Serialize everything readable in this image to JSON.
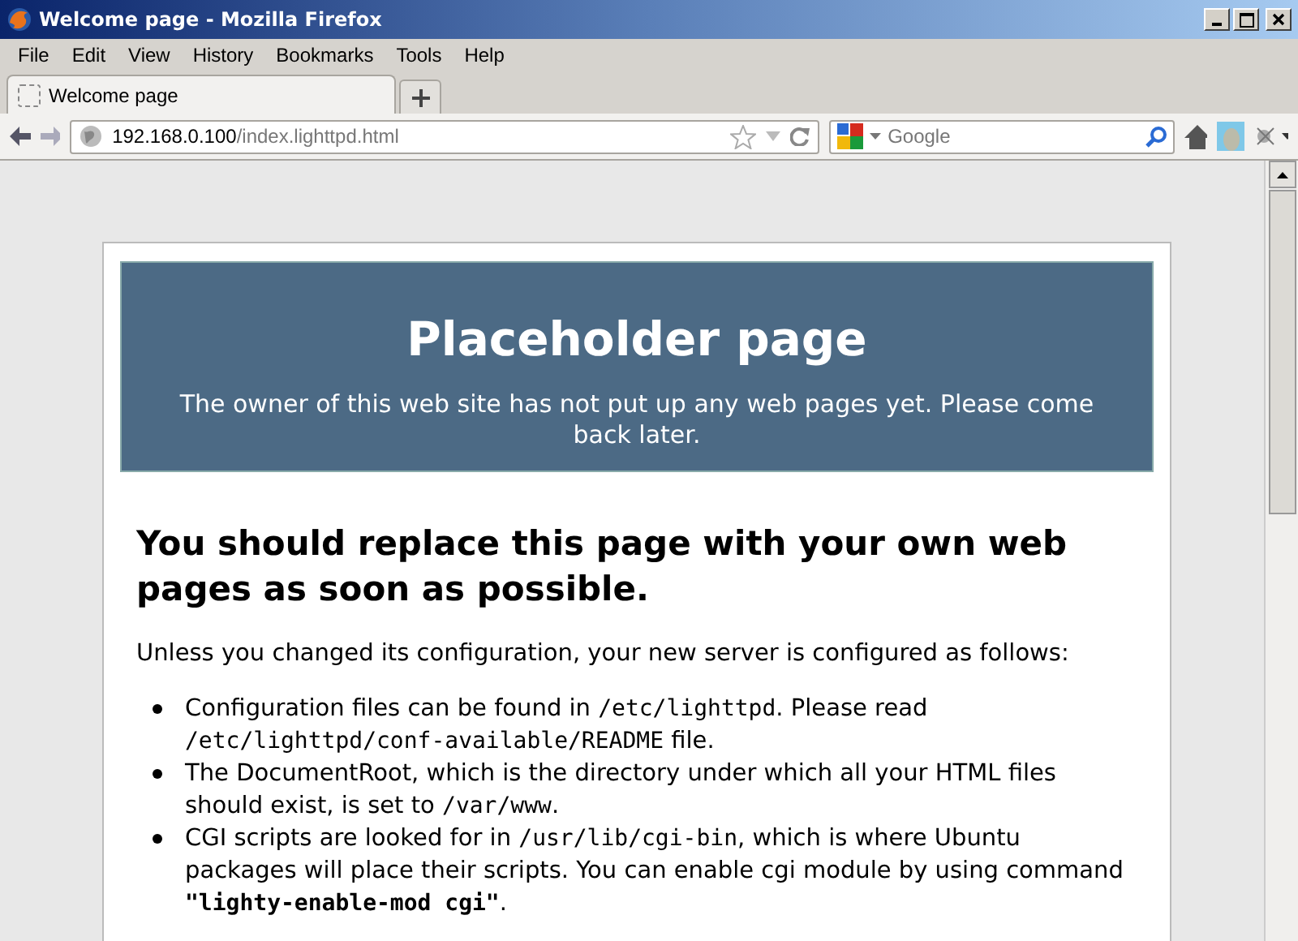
{
  "window": {
    "title": "Welcome page - Mozilla Firefox"
  },
  "menu": [
    {
      "label": "File"
    },
    {
      "label": "Edit"
    },
    {
      "label": "View"
    },
    {
      "label": "History"
    },
    {
      "label": "Bookmarks"
    },
    {
      "label": "Tools"
    },
    {
      "label": "Help"
    }
  ],
  "tabs": [
    {
      "label": "Welcome page",
      "selected": true
    }
  ],
  "address": {
    "host": "192.168.0.100",
    "path": "/index.lighttpd.html"
  },
  "search": {
    "placeholder": "Google"
  },
  "page": {
    "banner": {
      "title": "Placeholder page",
      "subtitle": "The owner of this web site has not put up any web pages yet. Please come back later."
    },
    "heading": "You should replace this page with your own web pages as soon as possible.",
    "intro": "Unless you changed its configuration, your new server is configured as follows:",
    "items": [
      [
        {
          "kind": "text",
          "text": "Configuration files can be found in "
        },
        {
          "kind": "code",
          "text": "/etc/lighttpd"
        },
        {
          "kind": "text",
          "text": ". Please read "
        },
        {
          "kind": "code",
          "text": "/etc/lighttpd/conf-available/README"
        },
        {
          "kind": "text",
          "text": " file."
        }
      ],
      [
        {
          "kind": "text",
          "text": "The DocumentRoot, which is the directory under which all your HTML files should exist, is set to "
        },
        {
          "kind": "code",
          "text": "/var/www"
        },
        {
          "kind": "text",
          "text": "."
        }
      ],
      [
        {
          "kind": "text",
          "text": "CGI scripts are looked for in "
        },
        {
          "kind": "code",
          "text": "/usr/lib/cgi-bin"
        },
        {
          "kind": "text",
          "text": ", which is where Ubuntu packages will place their scripts. You can enable cgi module by using command "
        },
        {
          "kind": "strong_code",
          "text": "\"lighty-enable-mod cgi\""
        },
        {
          "kind": "text",
          "text": "."
        }
      ]
    ]
  }
}
